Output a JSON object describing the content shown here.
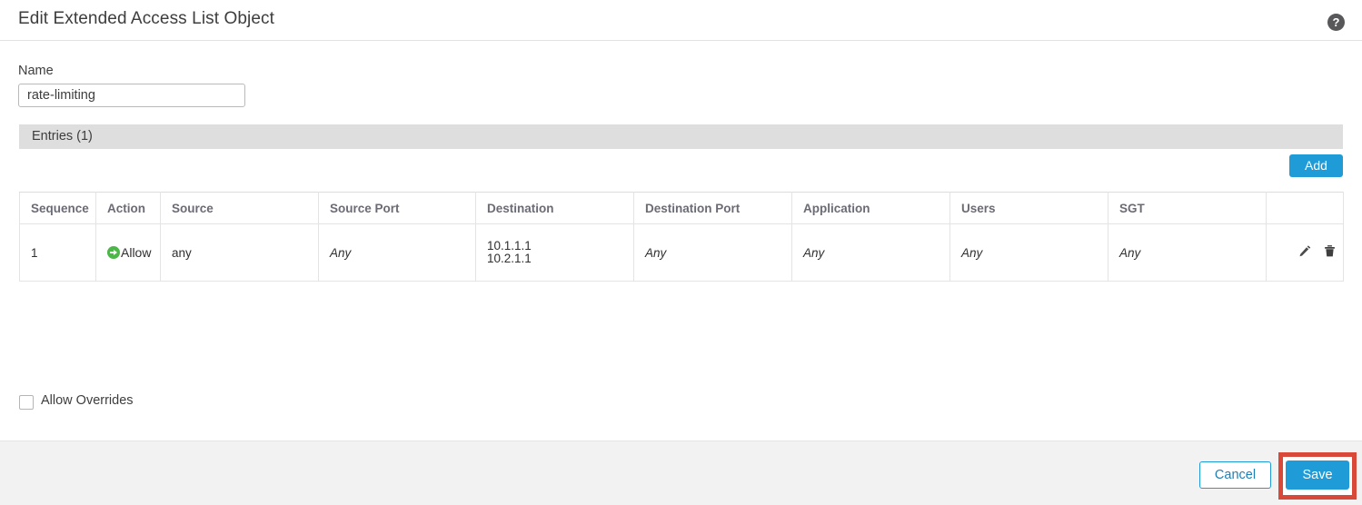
{
  "dialog": {
    "title": "Edit Extended Access List Object",
    "help_icon": "help-circle-icon",
    "help_glyph": "?"
  },
  "form": {
    "name_label": "Name",
    "name_value": "rate-limiting",
    "name_placeholder": ""
  },
  "entries_section": {
    "header": "Entries (1)",
    "add_label": "Add"
  },
  "table": {
    "columns": [
      "Sequence",
      "Action",
      "Source",
      "Source Port",
      "Destination",
      "Destination Port",
      "Application",
      "Users",
      "SGT",
      ""
    ],
    "rows": [
      {
        "sequence": "1",
        "action": "Allow",
        "action_icon": "allow-arrow-icon",
        "source": "any",
        "source_port": "Any",
        "destination_line1": "10.1.1.1",
        "destination_line2": "10.2.1.1",
        "destination_port": "Any",
        "application": "Any",
        "users": "Any",
        "sgt": "Any",
        "edit_icon": "pencil-icon",
        "delete_icon": "trash-icon"
      }
    ]
  },
  "options": {
    "allow_overrides_label": "Allow Overrides",
    "allow_overrides_checked": false
  },
  "footer": {
    "cancel_label": "Cancel",
    "save_label": "Save"
  },
  "colors": {
    "accent_blue": "#1f9bd7",
    "allow_green": "#4cb748",
    "highlight_red": "#d8493a",
    "entries_bar_gray": "#dedede",
    "footer_gray": "#f2f2f2"
  }
}
